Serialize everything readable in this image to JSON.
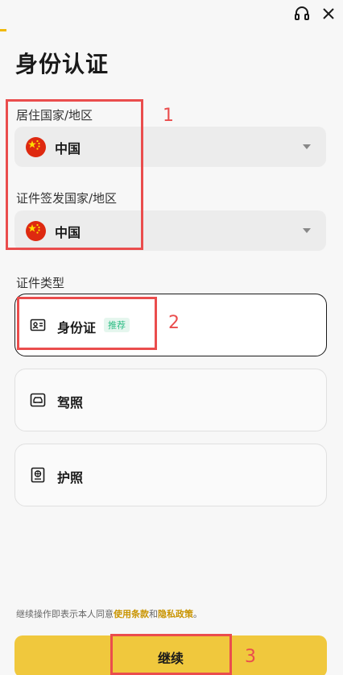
{
  "header": {
    "support_icon": "headset-icon",
    "close_icon": "close-icon"
  },
  "page": {
    "title": "身份认证"
  },
  "residence": {
    "label": "居住国家/地区",
    "value": "中国",
    "flag_icon": "china-flag-icon"
  },
  "issuing": {
    "label": "证件签发国家/地区",
    "value": "中国",
    "flag_icon": "china-flag-icon"
  },
  "doc_type": {
    "label": "证件类型",
    "options": [
      {
        "label": "身份证",
        "badge": "推荐",
        "icon": "id-card-icon",
        "selected": true
      },
      {
        "label": "驾照",
        "icon": "driver-license-icon",
        "selected": false
      },
      {
        "label": "护照",
        "icon": "passport-icon",
        "selected": false
      }
    ]
  },
  "annotations": [
    "1",
    "2",
    "3"
  ],
  "footer": {
    "terms_prefix": "继续操作即表示本人同意",
    "terms_link": "使用条款",
    "terms_and": "和",
    "privacy_link": "隐私政策",
    "terms_suffix": "。",
    "continue_label": "继续"
  },
  "colors": {
    "accent": "#f0c83d",
    "link": "#c99400",
    "badge_text": "#2ebd85",
    "annotation": "#ea4d4d"
  }
}
